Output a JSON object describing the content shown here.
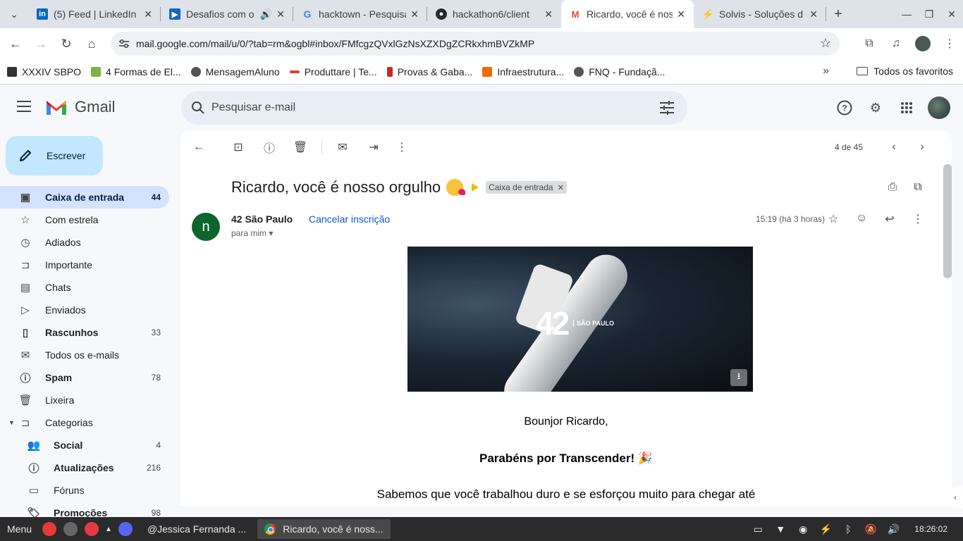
{
  "browser": {
    "tabs": [
      {
        "title": "(5) Feed | LinkedIn",
        "favicon": "linkedin-icon",
        "close": "✕"
      },
      {
        "title": "Desafios com o",
        "favicon": "video-icon",
        "close": "✕"
      },
      {
        "title": "hacktown - Pesquisa",
        "favicon": "google-icon",
        "close": "✕"
      },
      {
        "title": "hackathon6/client",
        "favicon": "github-icon",
        "close": "✕"
      },
      {
        "title": "Ricardo, você é nosso",
        "favicon": "gmail-icon",
        "close": "✕"
      },
      {
        "title": "Solvis - Soluções d",
        "favicon": "solvis-icon",
        "close": "✕"
      }
    ],
    "new_tab": "+",
    "url": "mail.google.com/mail/u/0/?tab=rm&ogbl#inbox/FMfcgzQVxlGzNsXZXDgZCRkxhmBVZkMP",
    "bookmarks": [
      {
        "label": "XXXIV SBPO",
        "color": "#333"
      },
      {
        "label": "4 Formas de El...",
        "color": "#7cb342"
      },
      {
        "label": "MensagemAluno",
        "color": "#555"
      },
      {
        "label": "Produttare | Te...",
        "color": "#e53935"
      },
      {
        "label": "Provas & Gaba...",
        "color": "#c62828"
      },
      {
        "label": "Infraestrutura...",
        "color": "#ef6c00"
      },
      {
        "label": "FNQ - Fundaçã...",
        "color": "#555"
      }
    ],
    "bookmarks_more": "»",
    "all_bookmarks": "Todos os favoritos"
  },
  "gmail": {
    "logo_text": "Gmail",
    "search_placeholder": "Pesquisar e-mail",
    "compose": "Escrever",
    "nav": [
      {
        "label": "Caixa de entrada",
        "count": "44",
        "icon": "inbox-icon",
        "active": true
      },
      {
        "label": "Com estrela",
        "count": "",
        "icon": "star-icon"
      },
      {
        "label": "Adiados",
        "count": "",
        "icon": "clock-icon"
      },
      {
        "label": "Importante",
        "count": "",
        "icon": "label-important-icon"
      },
      {
        "label": "Chats",
        "count": "",
        "icon": "chat-icon"
      },
      {
        "label": "Enviados",
        "count": "",
        "icon": "send-icon"
      },
      {
        "label": "Rascunhos",
        "count": "33",
        "icon": "draft-icon",
        "bold": true
      },
      {
        "label": "Todos os e-mails",
        "count": "",
        "icon": "all-mail-icon"
      },
      {
        "label": "Spam",
        "count": "78",
        "icon": "spam-icon",
        "bold": true
      },
      {
        "label": "Lixeira",
        "count": "",
        "icon": "trash-icon"
      },
      {
        "label": "Categorias",
        "count": "",
        "icon": "label-icon"
      },
      {
        "label": "Social",
        "count": "4",
        "icon": "people-icon",
        "bold": true
      },
      {
        "label": "Atualizações",
        "count": "216",
        "icon": "info-icon",
        "bold": true
      },
      {
        "label": "Fóruns",
        "count": "",
        "icon": "forum-icon"
      },
      {
        "label": "Promoções",
        "count": "98",
        "icon": "tag-icon",
        "bold": true
      }
    ],
    "pager": "4 de 45",
    "email": {
      "subject": "Ricardo, você é nosso orgulho",
      "label_chip": "Caixa de entrada",
      "sender_initial": "n",
      "sender_name": "42 São Paulo",
      "unsubscribe": "Cancelar inscrição",
      "to": "para mim",
      "time": "15:19 (há 3 horas)",
      "banner_brand": "42",
      "banner_city": "SÃO PAULO",
      "greeting": "Bounjor Ricardo,",
      "headline": "Parabéns por Transcender! 🎉",
      "para": "Sabemos que você trabalhou duro e se esforçou muito para chegar até"
    }
  },
  "taskbar": {
    "menu": "Menu",
    "windows": [
      "@Jessica Fernanda ...",
      "Ricardo, você é noss..."
    ],
    "clock": "18:26:02"
  }
}
